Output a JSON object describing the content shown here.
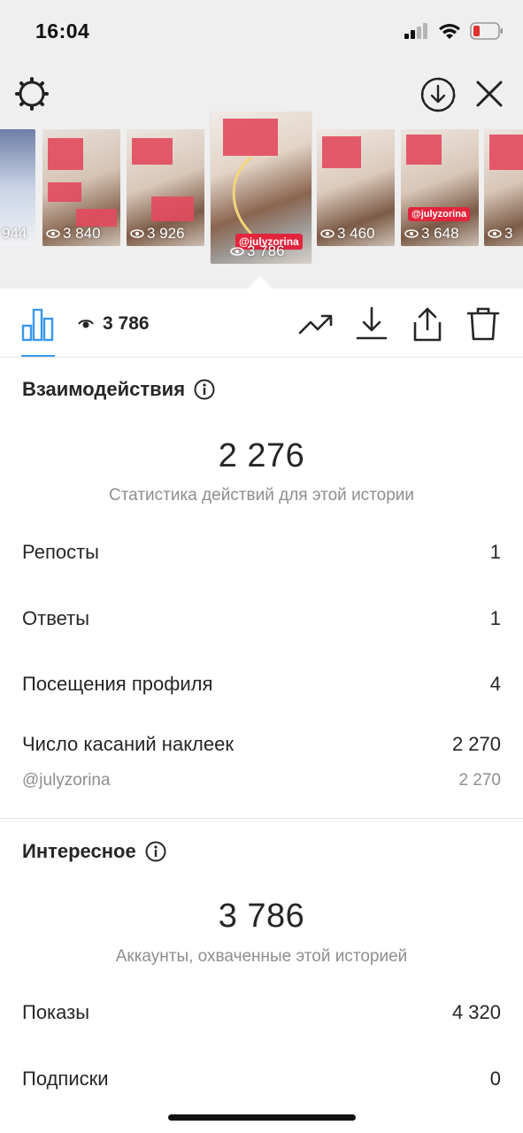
{
  "status_bar": {
    "time": "16:04",
    "icons": [
      "signal-icon",
      "wifi-icon",
      "battery-low-icon"
    ],
    "battery_color": "#e0332f"
  },
  "toolbar": {
    "icons": [
      "gear-icon",
      "download-circle-icon",
      "close-icon"
    ]
  },
  "thumbnails": [
    {
      "views": "944",
      "tag": ""
    },
    {
      "views": "3 840",
      "tag": ""
    },
    {
      "views": "3 926",
      "tag": ""
    },
    {
      "views": "3 786",
      "tag": "@julyzorina",
      "active": true
    },
    {
      "views": "3 460",
      "tag": ""
    },
    {
      "views": "3 648",
      "tag": "@julyzorina"
    },
    {
      "views": "3",
      "tag": ""
    }
  ],
  "action_bar": {
    "reach": "3 786",
    "icons": [
      "bar-chart-icon",
      "eye-icon",
      "trend-icon",
      "download-icon",
      "share-icon",
      "trash-icon"
    ],
    "accent": "#3897f0"
  },
  "interactions": {
    "title": "Взаимодействия",
    "total": "2 276",
    "caption": "Статистика действий для этой истории",
    "rows": [
      {
        "label": "Репосты",
        "value": "1"
      },
      {
        "label": "Ответы",
        "value": "1"
      },
      {
        "label": "Посещения профиля",
        "value": "4"
      },
      {
        "label": "Число касаний наклеек",
        "value": "2 270"
      }
    ],
    "sub_row": {
      "label": "@julyzorina",
      "value": "2 270"
    }
  },
  "discovery": {
    "title": "Интересное",
    "total": "3 786",
    "caption": "Аккаунты, охваченные этой историей",
    "rows": [
      {
        "label": "Показы",
        "value": "4 320"
      },
      {
        "label": "Подписки",
        "value": "0"
      }
    ]
  }
}
